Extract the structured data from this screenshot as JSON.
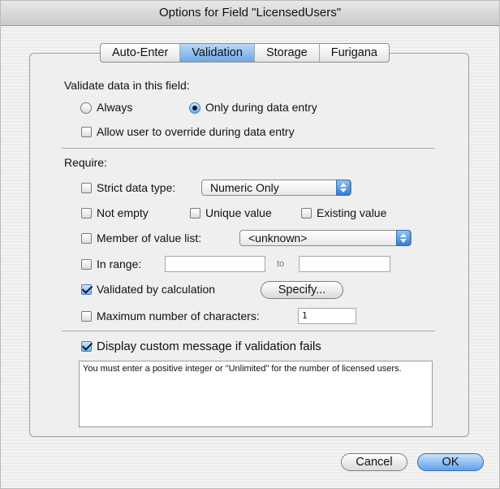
{
  "window": {
    "title": "Options for Field \"LicensedUsers\""
  },
  "tabs": [
    {
      "label": "Auto-Enter",
      "selected": false
    },
    {
      "label": "Validation",
      "selected": true
    },
    {
      "label": "Storage",
      "selected": false
    },
    {
      "label": "Furigana",
      "selected": false
    }
  ],
  "validate": {
    "heading": "Validate data in this field:",
    "always_label": "Always",
    "during_entry_label": "Only during data entry",
    "selected": "during_entry",
    "override_label": "Allow user to override during data entry",
    "override_checked": false
  },
  "require": {
    "heading": "Require:",
    "strict_label": "Strict data type:",
    "strict_checked": false,
    "strict_value": "Numeric Only",
    "not_empty_label": "Not empty",
    "not_empty_checked": false,
    "unique_label": "Unique value",
    "unique_checked": false,
    "existing_label": "Existing value",
    "existing_checked": false,
    "member_label": "Member of value list:",
    "member_checked": false,
    "member_value": "<unknown>",
    "range_label": "In range:",
    "range_checked": false,
    "range_from": "",
    "range_to_label": "to",
    "range_to": "",
    "calc_label": "Validated by calculation",
    "calc_checked": true,
    "specify_label": "Specify...",
    "max_label": "Maximum number of characters:",
    "max_checked": false,
    "max_value": "1"
  },
  "custom_message": {
    "label": "Display custom message if validation fails",
    "checked": true,
    "text": "You must enter a positive integer or \"Unlimited\" for the number of licensed users."
  },
  "buttons": {
    "cancel": "Cancel",
    "ok": "OK"
  },
  "colors": {
    "accent": "#6ea9e6",
    "panel": "#efefef"
  }
}
